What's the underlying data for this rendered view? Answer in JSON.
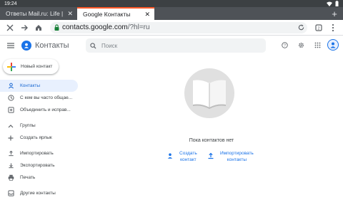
{
  "status_bar": {
    "time": "19:24"
  },
  "browser": {
    "tabs": [
      {
        "title": "Ответы Mail.ru: Life |",
        "close": "✕"
      },
      {
        "title": "Google Контакты",
        "close": "✕"
      }
    ],
    "new_tab": "+",
    "url_host": "contacts.google.com",
    "url_path": "/?hl=ru"
  },
  "app": {
    "title": "Контакты",
    "search_placeholder": "Поиск"
  },
  "sidebar": {
    "new_contact_label": "Новый контакт",
    "items": [
      {
        "label": "Контакты",
        "icon": "person-icon"
      },
      {
        "label": "С кем вы часто общае...",
        "icon": "history-icon"
      },
      {
        "label": "Объединить и исправ...",
        "icon": "merge-icon"
      },
      {
        "label": "Группы",
        "icon": "chevron-up-icon"
      },
      {
        "label": "Создать ярлык",
        "icon": "plus-icon"
      },
      {
        "label": "Импортировать",
        "icon": "upload-icon"
      },
      {
        "label": "Экспортировать",
        "icon": "download-icon"
      },
      {
        "label": "Печать",
        "icon": "print-icon"
      },
      {
        "label": "Другие контакты",
        "icon": "inbox-icon"
      }
    ]
  },
  "main": {
    "empty_text": "Пока контактов нет",
    "create_line1": "Создать",
    "create_line2": "контакт",
    "import_line1": "Импортировать",
    "import_line2": "контакты"
  },
  "colors": {
    "accent": "#1a73e8",
    "active_bg": "#e8f0fe",
    "tab_indicator": "#ff5a2a"
  }
}
